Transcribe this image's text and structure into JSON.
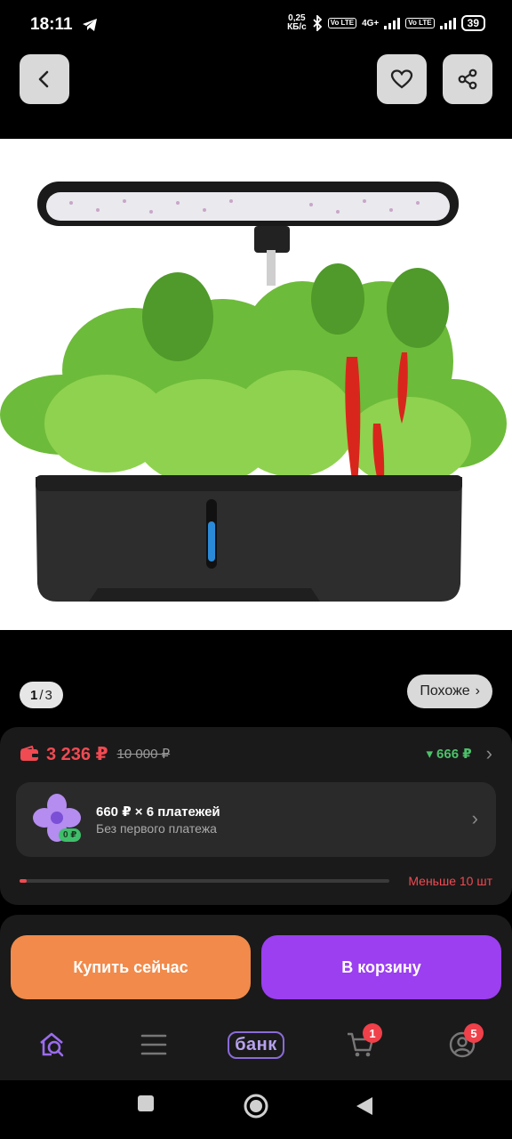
{
  "status_bar": {
    "time": "18:11",
    "net_speed_value": "0,25",
    "net_speed_unit": "КБ/с",
    "network_type": "4G+",
    "volte_label": "Vo LTE",
    "battery": "39"
  },
  "header": {
    "back_icon": "chevron-left-icon",
    "favorite_icon": "heart-icon",
    "share_icon": "share-icon"
  },
  "gallery": {
    "current": "1",
    "separator": "/",
    "total": "3",
    "similar_label": "Похоже",
    "similar_chevron": "›"
  },
  "price": {
    "current": "3 236 ₽",
    "old": "10 000 ₽",
    "discount_arrow": "▾",
    "discount": "666 ₽",
    "chevron": "›",
    "accent_color": "#f04a52",
    "discount_color": "#4cc16a"
  },
  "installment": {
    "badge": "0 ₽",
    "title": "660 ₽ × 6 платежей",
    "subtitle": "Без первого платежа",
    "chevron": "›"
  },
  "stock": {
    "label": "Меньше 10 шт",
    "level_fraction": 0.02
  },
  "actions": {
    "buy_now": "Купить сейчас",
    "add_to_cart": "В корзину",
    "buy_color": "#f18a4a",
    "cart_color": "#9b3ff0"
  },
  "bottom_nav": {
    "items": [
      {
        "icon": "home-search-icon"
      },
      {
        "icon": "catalog-menu-icon"
      },
      {
        "icon": "bank-icon",
        "label": "банк"
      },
      {
        "icon": "cart-icon",
        "badge": "1"
      },
      {
        "icon": "profile-icon",
        "badge": "5"
      }
    ]
  }
}
